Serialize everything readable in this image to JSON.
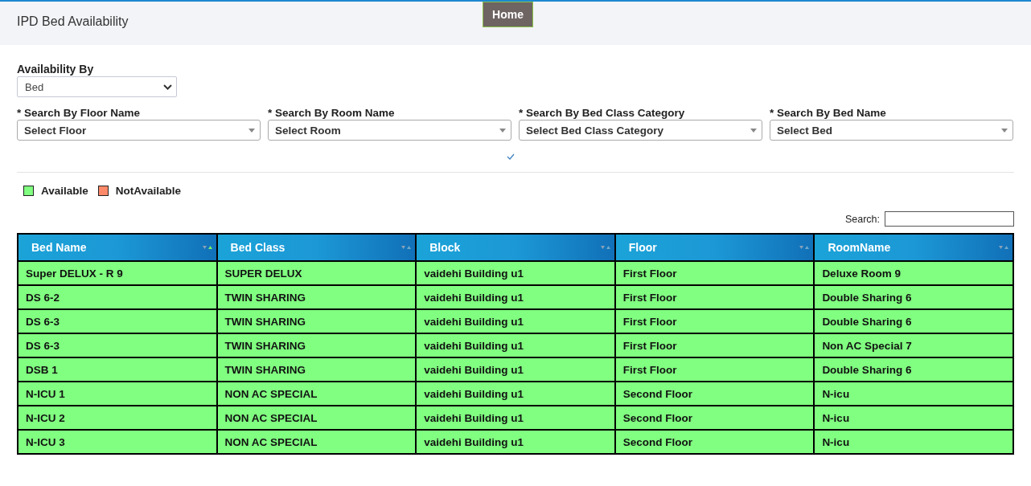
{
  "header": {
    "title": "IPD Bed Availability",
    "home_button": "Home"
  },
  "availability": {
    "label": "Availability By",
    "value": "Bed"
  },
  "filters": [
    {
      "label": "Search By Floor Name",
      "required_mark": "*",
      "placeholder": "Select Floor"
    },
    {
      "label": "Search By Room Name",
      "required_mark": "*",
      "placeholder": "Select Room"
    },
    {
      "label": "Search By Bed Class Category",
      "required_mark": "*",
      "placeholder": "Select Bed Class Category"
    },
    {
      "label": "Search By Bed Name",
      "required_mark": "*",
      "placeholder": "Select Bed"
    }
  ],
  "legend": [
    {
      "label": "Available",
      "color": "#80ff80"
    },
    {
      "label": "NotAvailable",
      "color": "#ff8a6a"
    }
  ],
  "search": {
    "label": "Search:"
  },
  "table": {
    "columns": [
      {
        "label": "Bed Name",
        "sorted": true
      },
      {
        "label": "Bed Class",
        "sorted": false
      },
      {
        "label": "Block",
        "sorted": false
      },
      {
        "label": "Floor",
        "sorted": false
      },
      {
        "label": "RoomName",
        "sorted": false
      }
    ],
    "rows": [
      {
        "available": true,
        "cells": [
          "Super DELUX - R 9",
          "SUPER DELUX",
          "vaidehi Building u1",
          "First Floor",
          "Deluxe Room 9"
        ]
      },
      {
        "available": true,
        "cells": [
          "DS 6-2",
          "TWIN SHARING",
          "vaidehi Building u1",
          "First Floor",
          "Double Sharing 6"
        ]
      },
      {
        "available": true,
        "cells": [
          "DS 6-3",
          "TWIN SHARING",
          "vaidehi Building u1",
          "First Floor",
          "Double Sharing 6"
        ]
      },
      {
        "available": true,
        "cells": [
          "DS 6-3",
          "TWIN SHARING",
          "vaidehi Building u1",
          "First Floor",
          "Non AC Special 7"
        ]
      },
      {
        "available": true,
        "cells": [
          "DSB 1",
          "TWIN SHARING",
          "vaidehi Building u1",
          "First Floor",
          "Double Sharing 6"
        ]
      },
      {
        "available": true,
        "cells": [
          "N-ICU 1",
          "NON AC SPECIAL",
          "vaidehi Building u1",
          "Second Floor",
          "N-icu"
        ]
      },
      {
        "available": true,
        "cells": [
          "N-ICU 2",
          "NON AC SPECIAL",
          "vaidehi Building u1",
          "Second Floor",
          "N-icu"
        ]
      },
      {
        "available": true,
        "cells": [
          "N-ICU 3",
          "NON AC SPECIAL",
          "vaidehi Building u1",
          "Second Floor",
          "N-icu"
        ]
      }
    ]
  }
}
